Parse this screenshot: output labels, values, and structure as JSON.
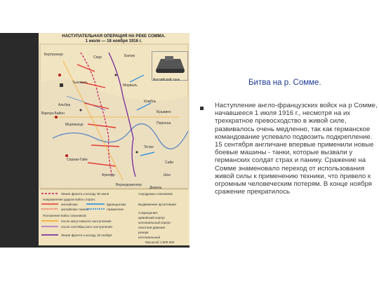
{
  "map": {
    "title": "НАСТУПАТЕЛЬНАЯ ОПЕРАЦИЯ НА РЕКЕ СОММА.",
    "dates": "1 июля — 18 ноября 1916 г.",
    "tank_caption": "Английский танк",
    "places": [
      "Бертранкур",
      "Серр",
      "Бапом",
      "Тьепваль",
      "Альбер",
      "Варлуа-Байон",
      "Морланкур",
      "Перонна",
      "Серизи-Гайи",
      "Эстре",
      "Фукокур",
      "Шон",
      "Верандовиллер",
      "Бушавен",
      "Комбль",
      "Сайи",
      "Морваль",
      "Дюкель"
    ],
    "legend": {
      "line1": "Линия фронта к исходу 30 июня",
      "directions": "Направления ударов войск сторон:",
      "english": "английских",
      "french": "французских",
      "english_tanks": "английских танков",
      "german": "германских",
      "positions": "Положение войск союзников:",
      "after_aug": "после августовского наступления",
      "after_sep": "после сентябрьского наступления",
      "line_nov": "Линия фронта к исходу 18 ноября",
      "airfields": "Аэродромы союзников",
      "artillery": "Выдвижение артиллерии",
      "abbreviations": "Сокращения:",
      "ak": "армейский корпус",
      "kk": "колониальный корпус",
      "pd": "пехотная дивизия",
      "res": "резерв",
      "col": "колониальный",
      "scale": "Масштаб 1:500 000"
    }
  },
  "slide": {
    "heading": "Битва на р. Сомме.",
    "body": "Наступление англо-французских войск на р Сомме, начавшееся 1 июля 1916 г., несмотря на их трехкратное превосходство в живой силе, развивалось очень медленно, так как германское командование успевало подвозить подкрепление. 15 сентября англичане впервые применили новые боевые машины - танки, которые вызвали у германских солдат страх и панику. Сражение на Сомме знаменовало переход от использования живой силы к применению техники, что привело к огромным человеческим потерям. В конце ноября сражение прекратилось"
  }
}
